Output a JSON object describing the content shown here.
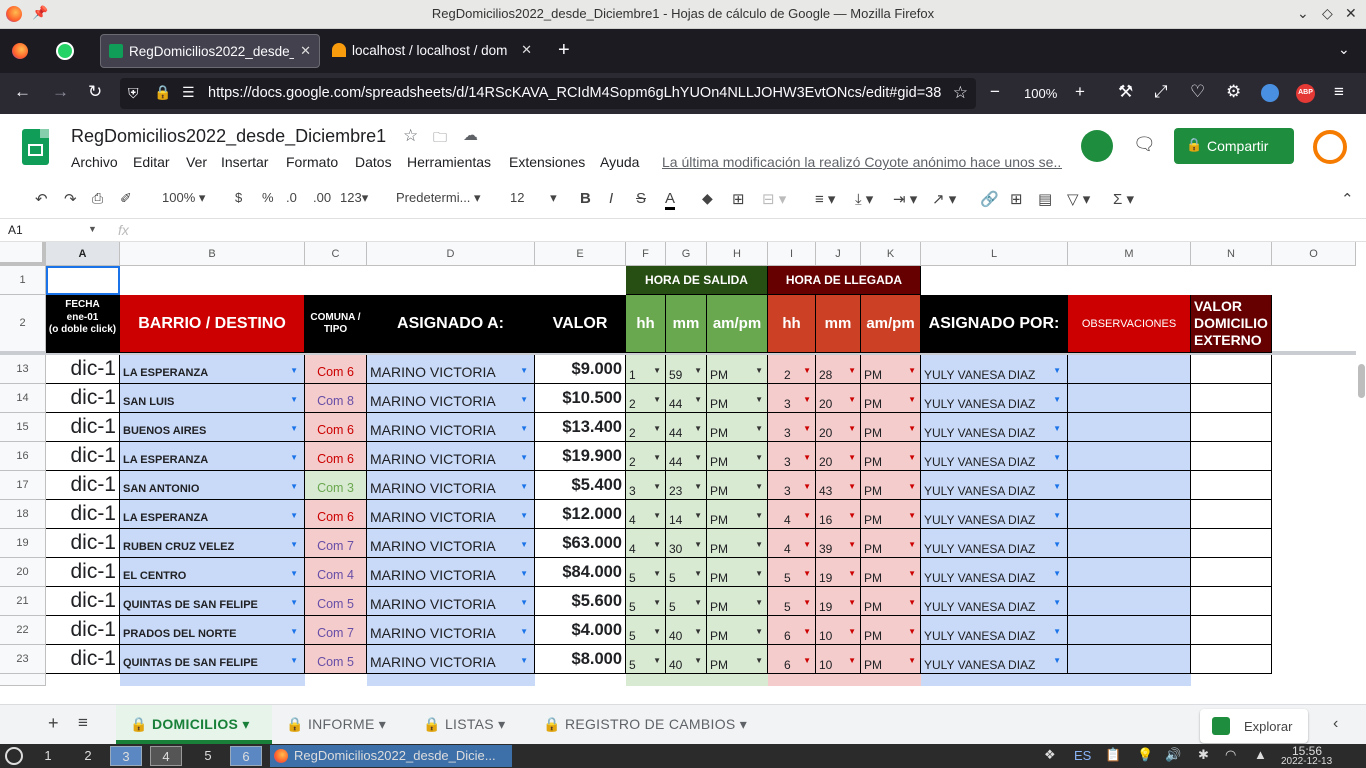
{
  "window": {
    "title": "RegDomicilios2022_desde_Diciembre1 - Hojas de cálculo de Google — Mozilla Firefox"
  },
  "tabs": [
    {
      "label": "RegDomicilios2022_desde_Diciembre1"
    },
    {
      "label": "localhost / localhost / dom"
    }
  ],
  "nav": {
    "url": "https://docs.google.com/spreadsheets/d/14RScKAVA_RCIdM4Sopm6gLhYUOn4NLLJOHW3EvtONcs/edit#gid=38",
    "zoom": "100%",
    "abp": "ABP"
  },
  "doc": {
    "title": "RegDomicilios2022_desde_Diciembre1",
    "last_edit": "La última modificación la realizó Coyote anónimo hace unos se...",
    "share": "Compartir"
  },
  "menu": [
    "Archivo",
    "Editar",
    "Ver",
    "Insertar",
    "Formato",
    "Datos",
    "Herramientas",
    "Extensiones",
    "Ayuda"
  ],
  "toolbar": {
    "zoom": "100%",
    "currency": "$",
    "percent": "%",
    "dec_less": ".0",
    "dec_more": ".00",
    "format": "123",
    "font": "Predetermi...",
    "size": "12",
    "bold": "B",
    "italic": "I",
    "strike": "S",
    "color": "A"
  },
  "formula": {
    "cellref": "A1",
    "fx": "fx",
    "value": ""
  },
  "columns": [
    "A",
    "B",
    "C",
    "D",
    "E",
    "F",
    "G",
    "H",
    "I",
    "J",
    "K",
    "L",
    "M",
    "N",
    "O"
  ],
  "header": {
    "salida": "HORA DE SALIDA",
    "llegada": "HORA DE LLEGADA",
    "fecha": "FECHA",
    "fecha2": "ene-01",
    "fecha3": "(o doble click)",
    "barrio": "BARRIO / DESTINO",
    "comuna": "COMUNA / TIPO",
    "asignado": "ASIGNADO A:",
    "valor": "VALOR",
    "hh": "hh",
    "mm": "mm",
    "ampm": "am/pm",
    "hh2": "hh",
    "mm2": "mm",
    "ampm2": "am/pm",
    "asignado_por": "ASIGNADO POR:",
    "obs": "OBSERVACIONES",
    "externo": "VALOR DOMICILIO EXTERNO"
  },
  "rows": [
    {
      "n": "13",
      "fecha": "dic-1",
      "barrio": "LA ESPERANZA",
      "comuna": "Com 6",
      "asig": "MARINO VICTORIA",
      "valor": "$9.000",
      "sh": "1",
      "sm": "59",
      "sp": "PM",
      "lh": "2",
      "lm": "28",
      "lp": "PM",
      "por": "YULY  VANESA DIAZ"
    },
    {
      "n": "14",
      "fecha": "dic-1",
      "barrio": "SAN LUIS",
      "comuna": "Com 8",
      "asig": "MARINO VICTORIA",
      "valor": "$10.500",
      "sh": "2",
      "sm": "44",
      "sp": "PM",
      "lh": "3",
      "lm": "20",
      "lp": "PM",
      "por": "YULY  VANESA DIAZ"
    },
    {
      "n": "15",
      "fecha": "dic-1",
      "barrio": "BUENOS AIRES",
      "comuna": "Com 6",
      "asig": "MARINO VICTORIA",
      "valor": "$13.400",
      "sh": "2",
      "sm": "44",
      "sp": "PM",
      "lh": "3",
      "lm": "20",
      "lp": "PM",
      "por": "YULY  VANESA DIAZ"
    },
    {
      "n": "16",
      "fecha": "dic-1",
      "barrio": "LA ESPERANZA",
      "comuna": "Com 6",
      "asig": "MARINO VICTORIA",
      "valor": "$19.900",
      "sh": "2",
      "sm": "44",
      "sp": "PM",
      "lh": "3",
      "lm": "20",
      "lp": "PM",
      "por": "YULY  VANESA DIAZ"
    },
    {
      "n": "17",
      "fecha": "dic-1",
      "barrio": "SAN ANTONIO",
      "comuna": "Com 3",
      "asig": "MARINO VICTORIA",
      "valor": "$5.400",
      "sh": "3",
      "sm": "23",
      "sp": "PM",
      "lh": "3",
      "lm": "43",
      "lp": "PM",
      "por": "YULY  VANESA DIAZ"
    },
    {
      "n": "18",
      "fecha": "dic-1",
      "barrio": "LA ESPERANZA",
      "comuna": "Com 6",
      "asig": "MARINO VICTORIA",
      "valor": "$12.000",
      "sh": "4",
      "sm": "14",
      "sp": "PM",
      "lh": "4",
      "lm": "16",
      "lp": "PM",
      "por": "YULY  VANESA DIAZ"
    },
    {
      "n": "19",
      "fecha": "dic-1",
      "barrio": "RUBEN CRUZ VELEZ",
      "comuna": "Com 7",
      "asig": "MARINO VICTORIA",
      "valor": "$63.000",
      "sh": "4",
      "sm": "30",
      "sp": "PM",
      "lh": "4",
      "lm": "39",
      "lp": "PM",
      "por": "YULY  VANESA DIAZ"
    },
    {
      "n": "20",
      "fecha": "dic-1",
      "barrio": "EL CENTRO",
      "comuna": "Com 4",
      "asig": "MARINO VICTORIA",
      "valor": "$84.000",
      "sh": "5",
      "sm": "5",
      "sp": "PM",
      "lh": "5",
      "lm": "19",
      "lp": "PM",
      "por": "YULY  VANESA DIAZ"
    },
    {
      "n": "21",
      "fecha": "dic-1",
      "barrio": "QUINTAS DE SAN FELIPE",
      "comuna": "Com 5",
      "asig": "MARINO VICTORIA",
      "valor": "$5.600",
      "sh": "5",
      "sm": "5",
      "sp": "PM",
      "lh": "5",
      "lm": "19",
      "lp": "PM",
      "por": "YULY  VANESA DIAZ"
    },
    {
      "n": "22",
      "fecha": "dic-1",
      "barrio": "PRADOS DEL NORTE",
      "comuna": "Com 7",
      "asig": "MARINO VICTORIA",
      "valor": "$4.000",
      "sh": "5",
      "sm": "40",
      "sp": "PM",
      "lh": "6",
      "lm": "10",
      "lp": "PM",
      "por": "YULY  VANESA DIAZ"
    },
    {
      "n": "23",
      "fecha": "dic-1",
      "barrio": "QUINTAS DE SAN FELIPE",
      "comuna": "Com 5",
      "asig": "MARINO VICTORIA",
      "valor": "$8.000",
      "sh": "5",
      "sm": "40",
      "sp": "PM",
      "lh": "6",
      "lm": "10",
      "lp": "PM",
      "por": "YULY  VANESA DIAZ"
    }
  ],
  "comuna_colors": {
    "Com 3": "#d9ead3",
    "Com 3_text": "#6aa84f",
    "default": "#f4cccc",
    "Com 6_text": "#cc0000",
    "Com 8_text": "#674ea7",
    "Com 7_text": "#674ea7",
    "Com 4_text": "#674ea7",
    "Com 5_text": "#674ea7"
  },
  "sheets": [
    {
      "label": "DOMICILIOS"
    },
    {
      "label": "INFORME"
    },
    {
      "label": "LISTAS"
    },
    {
      "label": "REGISTRO DE CAMBIOS"
    }
  ],
  "explore": "Explorar",
  "taskbar": {
    "workspaces": [
      "1",
      "2",
      "3",
      "4",
      "5",
      "6"
    ],
    "app": "RegDomicilios2022_desde_Dicie...",
    "lang": "ES",
    "time": "15:56",
    "date": "2022-12-13"
  }
}
